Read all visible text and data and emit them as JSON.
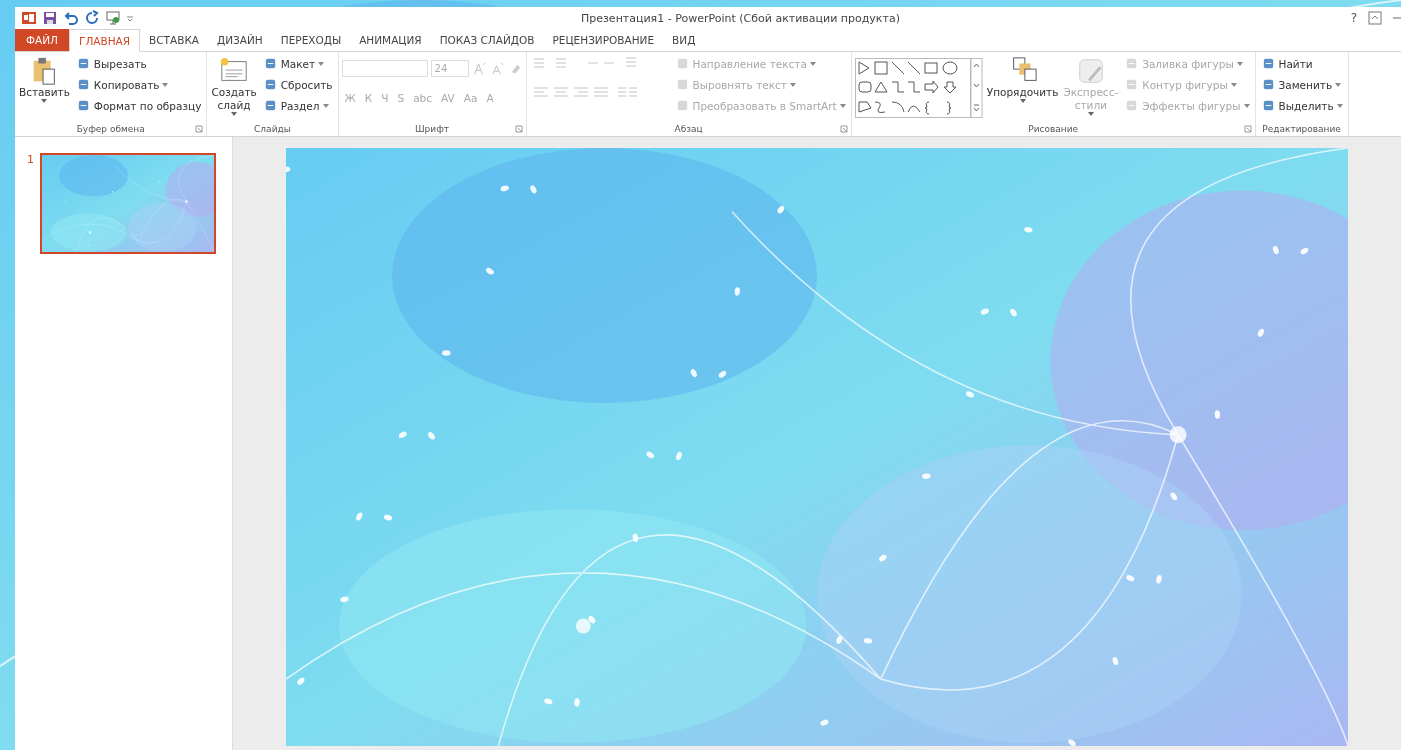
{
  "window": {
    "title": "Презентация1 - PowerPoint (Сбой активации продукта)",
    "help": "?"
  },
  "tabs": [
    {
      "label": "ФАЙЛ",
      "kind": "file",
      "selected": false
    },
    {
      "label": "ГЛАВНАЯ",
      "kind": "tab",
      "selected": true
    },
    {
      "label": "ВСТАВКА",
      "kind": "tab",
      "selected": false
    },
    {
      "label": "ДИЗАЙН",
      "kind": "tab",
      "selected": false
    },
    {
      "label": "ПЕРЕХОДЫ",
      "kind": "tab",
      "selected": false
    },
    {
      "label": "АНИМАЦИЯ",
      "kind": "tab",
      "selected": false
    },
    {
      "label": "ПОКАЗ СЛАЙДОВ",
      "kind": "tab",
      "selected": false
    },
    {
      "label": "РЕЦЕНЗИРОВАНИЕ",
      "kind": "tab",
      "selected": false
    },
    {
      "label": "ВИД",
      "kind": "tab",
      "selected": false
    }
  ],
  "ribbon": [
    {
      "kind": "buttons",
      "label": "Буфер обмена",
      "launcher": true,
      "large": [
        {
          "label": "Вставить",
          "dropdown": true,
          "disabled": false
        }
      ],
      "small": [
        {
          "label": "Вырезать",
          "dropdown": false,
          "disabled": false
        },
        {
          "label": "Копировать",
          "dropdown": true,
          "disabled": false
        },
        {
          "label": "Формат по образцу",
          "dropdown": false,
          "disabled": false
        }
      ]
    },
    {
      "kind": "buttons",
      "label": "Слайды",
      "launcher": false,
      "large": [
        {
          "label": "Создать слайд",
          "dropdown": true,
          "disabled": false
        }
      ],
      "small": [
        {
          "label": "Макет",
          "dropdown": true,
          "disabled": false
        },
        {
          "label": "Сбросить",
          "dropdown": false,
          "disabled": false
        },
        {
          "label": "Раздел",
          "dropdown": true,
          "disabled": false
        }
      ]
    },
    {
      "kind": "font",
      "label": "Шрифт",
      "launcher": true,
      "font_size": "24",
      "buttons": [
        "Ж",
        "К",
        "Ч",
        "S",
        "abc",
        "AV",
        "Aa",
        "A"
      ]
    },
    {
      "kind": "paragraph",
      "label": "Абзац",
      "launcher": true,
      "small": [
        {
          "label": "Направление текста",
          "dropdown": true,
          "disabled": true
        },
        {
          "label": "Выровнять текст",
          "dropdown": true,
          "disabled": true
        },
        {
          "label": "Преобразовать в SmartArt",
          "dropdown": true,
          "disabled": true
        }
      ]
    },
    {
      "kind": "drawing",
      "label": "Рисование",
      "launcher": true,
      "large": [
        {
          "label": "Упорядочить",
          "dropdown": true,
          "disabled": false
        },
        {
          "label": "Экспресс-стили",
          "dropdown": true,
          "disabled": true
        }
      ],
      "small": [
        {
          "label": "Заливка фигуры",
          "dropdown": true,
          "disabled": true
        },
        {
          "label": "Контур фигуры",
          "dropdown": true,
          "disabled": true
        },
        {
          "label": "Эффекты фигуры",
          "dropdown": true,
          "disabled": true
        }
      ]
    },
    {
      "kind": "buttons",
      "label": "Редактирование",
      "launcher": false,
      "small": [
        {
          "label": "Найти",
          "dropdown": false,
          "disabled": false
        },
        {
          "label": "Заменить",
          "dropdown": true,
          "disabled": false
        },
        {
          "label": "Выделить",
          "dropdown": true,
          "disabled": false
        }
      ]
    }
  ],
  "slides": [
    {
      "number": "1",
      "selected": true
    }
  ]
}
